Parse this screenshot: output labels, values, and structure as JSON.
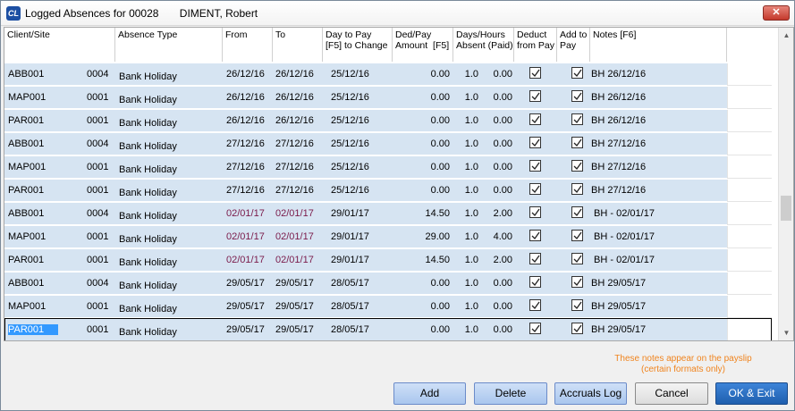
{
  "window": {
    "title": "Logged Absences for 00028       DIMENT, Robert",
    "app_icon": "CL",
    "close_glyph": "✕"
  },
  "columns": {
    "client_site": "Client/Site",
    "absence_type": "Absence Type",
    "from": "From",
    "to": "To",
    "day_to_pay": "Day to Pay\n[F5] to Change",
    "ded_pay": "Ded/Pay\nAmount  [F5]",
    "days_hours": "Days/Hours\nAbsent (Paid)",
    "deduct": "Deduct\nfrom Pay",
    "add_to": "Add to\nPay",
    "notes": "Notes [F6]"
  },
  "rows": [
    {
      "client": "ABB001",
      "site": "0004",
      "type": "Bank Holiday",
      "from": "26/12/16",
      "to": "26/12/16",
      "pay_day": "25/12/16",
      "amount": "0.00",
      "days": "1.0",
      "paid": "0.00",
      "deduct": true,
      "add": true,
      "notes": "BH 26/12/16",
      "highlight": false
    },
    {
      "client": "MAP001",
      "site": "0001",
      "type": "Bank Holiday",
      "from": "26/12/16",
      "to": "26/12/16",
      "pay_day": "25/12/16",
      "amount": "0.00",
      "days": "1.0",
      "paid": "0.00",
      "deduct": true,
      "add": true,
      "notes": "BH 26/12/16",
      "highlight": false
    },
    {
      "client": "PAR001",
      "site": "0001",
      "type": "Bank Holiday",
      "from": "26/12/16",
      "to": "26/12/16",
      "pay_day": "25/12/16",
      "amount": "0.00",
      "days": "1.0",
      "paid": "0.00",
      "deduct": true,
      "add": true,
      "notes": "BH 26/12/16",
      "highlight": false
    },
    {
      "client": "ABB001",
      "site": "0004",
      "type": "Bank Holiday",
      "from": "27/12/16",
      "to": "27/12/16",
      "pay_day": "25/12/16",
      "amount": "0.00",
      "days": "1.0",
      "paid": "0.00",
      "deduct": true,
      "add": true,
      "notes": "BH 27/12/16",
      "highlight": false
    },
    {
      "client": "MAP001",
      "site": "0001",
      "type": "Bank Holiday",
      "from": "27/12/16",
      "to": "27/12/16",
      "pay_day": "25/12/16",
      "amount": "0.00",
      "days": "1.0",
      "paid": "0.00",
      "deduct": true,
      "add": true,
      "notes": "BH 27/12/16",
      "highlight": false
    },
    {
      "client": "PAR001",
      "site": "0001",
      "type": "Bank Holiday",
      "from": "27/12/16",
      "to": "27/12/16",
      "pay_day": "25/12/16",
      "amount": "0.00",
      "days": "1.0",
      "paid": "0.00",
      "deduct": true,
      "add": true,
      "notes": "BH 27/12/16",
      "highlight": false
    },
    {
      "client": "ABB001",
      "site": "0004",
      "type": "Bank Holiday",
      "from": "02/01/17",
      "to": "02/01/17",
      "pay_day": "29/01/17",
      "amount": "14.50",
      "days": "1.0",
      "paid": "2.00",
      "deduct": true,
      "add": true,
      "notes": " BH - 02/01/17",
      "highlight": true
    },
    {
      "client": "MAP001",
      "site": "0001",
      "type": "Bank Holiday",
      "from": "02/01/17",
      "to": "02/01/17",
      "pay_day": "29/01/17",
      "amount": "29.00",
      "days": "1.0",
      "paid": "4.00",
      "deduct": true,
      "add": true,
      "notes": " BH - 02/01/17",
      "highlight": true
    },
    {
      "client": "PAR001",
      "site": "0001",
      "type": "Bank Holiday",
      "from": "02/01/17",
      "to": "02/01/17",
      "pay_day": "29/01/17",
      "amount": "14.50",
      "days": "1.0",
      "paid": "2.00",
      "deduct": true,
      "add": true,
      "notes": " BH - 02/01/17",
      "highlight": true
    },
    {
      "client": "ABB001",
      "site": "0004",
      "type": "Bank Holiday",
      "from": "29/05/17",
      "to": "29/05/17",
      "pay_day": "28/05/17",
      "amount": "0.00",
      "days": "1.0",
      "paid": "0.00",
      "deduct": true,
      "add": true,
      "notes": "BH 29/05/17",
      "highlight": false
    },
    {
      "client": "MAP001",
      "site": "0001",
      "type": "Bank Holiday",
      "from": "29/05/17",
      "to": "29/05/17",
      "pay_day": "28/05/17",
      "amount": "0.00",
      "days": "1.0",
      "paid": "0.00",
      "deduct": true,
      "add": true,
      "notes": "BH 29/05/17",
      "highlight": false
    },
    {
      "client": "PAR001",
      "site": "0001",
      "type": "Bank Holiday",
      "from": "29/05/17",
      "to": "29/05/17",
      "pay_day": "28/05/17",
      "amount": "0.00",
      "days": "1.0",
      "paid": "0.00",
      "deduct": true,
      "add": true,
      "notes": "BH 29/05/17",
      "highlight": false,
      "selected": true
    }
  ],
  "note": "These notes appear on the payslip\n(certain formats only)",
  "buttons": {
    "add": "Add",
    "delete": "Delete",
    "accruals": "Accruals Log",
    "cancel": "Cancel",
    "ok": "OK & Exit"
  },
  "scrollbar": {
    "up_icon": "▲",
    "down_icon": "▼"
  },
  "colors": {
    "row_band": "#d6e4f2",
    "highlight_date": "#7a1a4a",
    "note_text": "#f0841e",
    "primary_button": "#1f5fae",
    "selection": "#3399ff"
  }
}
